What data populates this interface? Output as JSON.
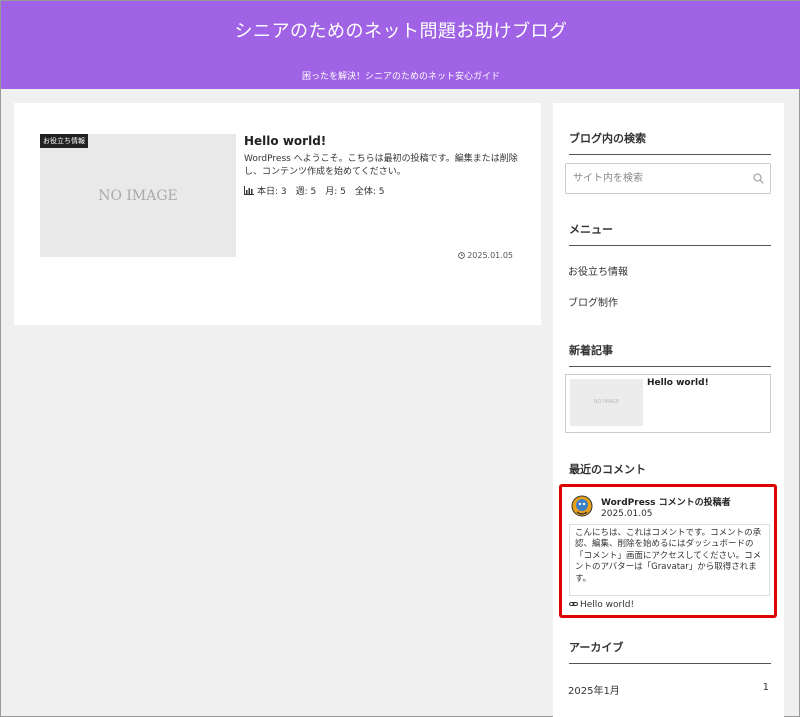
{
  "header": {
    "site_title": "シニアのためのネット問題お助けブログ",
    "description": "困ったを解決！シニアのためのネット安心ガイド"
  },
  "post": {
    "category": "お役立ち情報",
    "thumb_text": "NO IMAGE",
    "title": "Hello world!",
    "excerpt": "WordPress へようこそ。こちらは最初の投稿です。編集または削除し、コンテンツ作成を始めてください。",
    "views": "本日: 3　週: 5　月: 5　全体: 5",
    "date": "2025.01.05",
    "icons": [
      "bar-chart-icon",
      "clock-icon"
    ]
  },
  "sidebar": {
    "search": {
      "title": "ブログ内の検索",
      "placeholder": "サイト内を検索",
      "icon": "search-icon"
    },
    "menu": {
      "title": "メニュー",
      "items": [
        "お役立ち情報",
        "ブログ制作"
      ]
    },
    "new_posts": {
      "title": "新着記事",
      "thumb_text": "NO IMAGE",
      "item_title": "Hello world!"
    },
    "recent_comments": {
      "title": "最近のコメント",
      "author": "WordPress コメントの投稿者",
      "date": "2025.01.05",
      "body": "こんにちは、これはコメントです。コメントの承認、編集、削除を始めるにはダッシュボードの「コメント」画面にアクセスしてください。コメントのアバターは「Gravatar」から取得されます。",
      "link": "Hello world!",
      "highlight_color": "#e00000"
    },
    "archive": {
      "title": "アーカイブ",
      "month": "2025年1月",
      "count": "1"
    }
  },
  "colors": {
    "header_bg": "#a163e6",
    "page_bg": "#f0f0f0"
  }
}
